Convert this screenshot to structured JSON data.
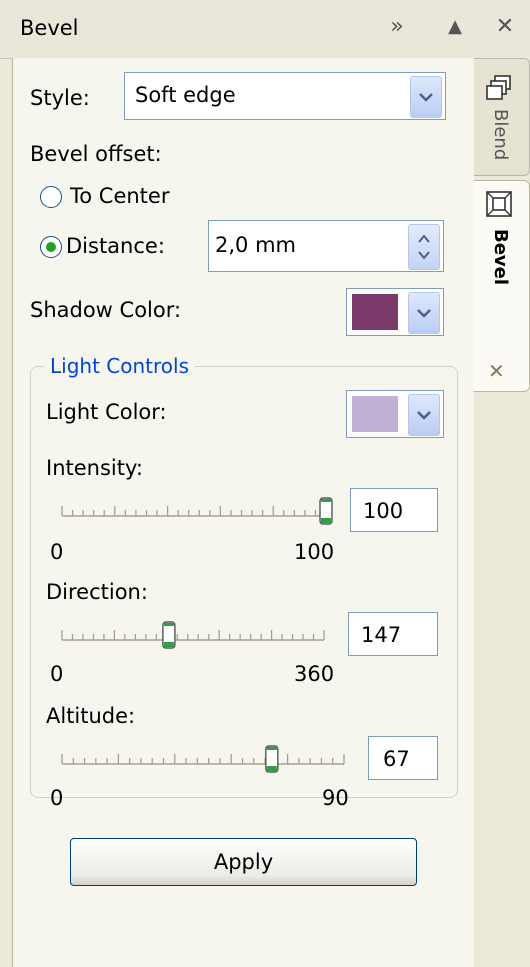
{
  "window": {
    "title": "Bevel",
    "expand_glyph": "»",
    "collapse_glyph": "▲",
    "close_glyph": "✕"
  },
  "style": {
    "label": "Style:",
    "value": "Soft edge"
  },
  "bevel_offset": {
    "label": "Bevel offset:",
    "to_center_label": "To Center",
    "distance_label": "Distance:",
    "distance_value": "2,0 mm",
    "selected": "distance"
  },
  "shadow_color": {
    "label": "Shadow Color:",
    "color": "#7b3a6b"
  },
  "light_controls": {
    "legend": "Light Controls",
    "light_color_label": "Light Color:",
    "light_color": "#c2b1d6",
    "intensity": {
      "label": "Intensity:",
      "value": "100",
      "min": "0",
      "max": "100",
      "fraction": 1.0
    },
    "direction": {
      "label": "Direction:",
      "value": "147",
      "min": "0",
      "max": "360",
      "fraction": 0.408
    },
    "altitude": {
      "label": "Altitude:",
      "value": "67",
      "min": "0",
      "max": "90",
      "fraction": 0.744
    }
  },
  "apply_label": "Apply",
  "side_tabs": {
    "blend_label": "Blend",
    "bevel_label": "Bevel",
    "close_glyph": "✕"
  },
  "colors": {
    "accent_blue": "#0046d5",
    "thumb_green": "#2ea043"
  }
}
